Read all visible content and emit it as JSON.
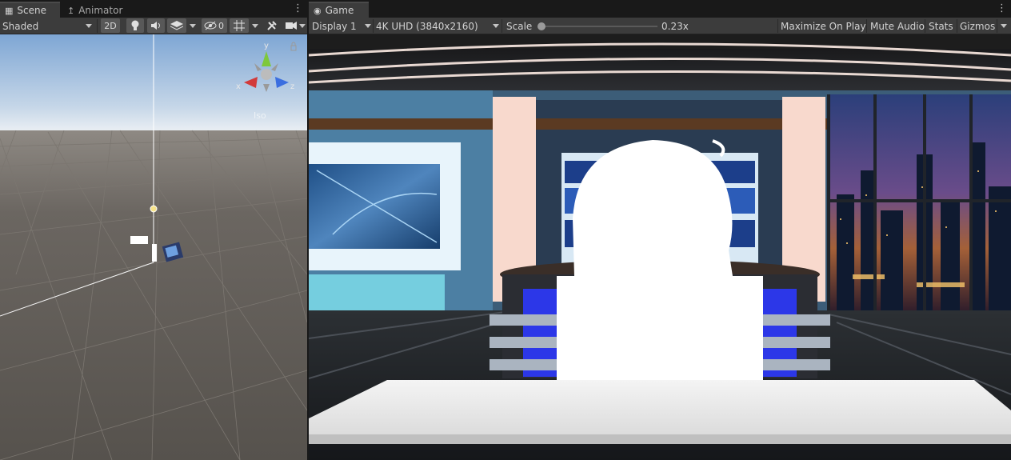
{
  "scene_panel": {
    "tabs": [
      {
        "label": "Scene",
        "icon": "grid-icon",
        "active": true
      },
      {
        "label": "Animator",
        "icon": "animator-icon",
        "active": false
      }
    ],
    "toolbar": {
      "draw_mode": "Shaded",
      "mode_2d": "2D",
      "hidden_count": "0"
    },
    "gizmo": {
      "y_label": "y",
      "x_label": "x",
      "z_label": "z",
      "projection_label": "Iso"
    }
  },
  "game_panel": {
    "tabs": [
      {
        "label": "Game",
        "icon": "gamepad-icon",
        "active": true
      }
    ],
    "toolbar": {
      "display": "Display 1",
      "resolution": "4K UHD (3840x2160)",
      "scale_label": "Scale",
      "scale_value": "0.23x",
      "scale_fraction": 0.0,
      "maximize": "Maximize On Play",
      "mute": "Mute Audio",
      "stats": "Stats",
      "gizmos": "Gizmos"
    }
  },
  "colors": {
    "editor_bg": "#191919",
    "toolbar_bg": "#3c3c3c",
    "tab_active": "#3c3c3c",
    "button_bg": "#585858",
    "sky_top": "#7ea6d4",
    "ground": "#5d5954",
    "axis_y": "#7ec83c",
    "axis_x": "#d23a3a",
    "axis_z": "#3a6ee0"
  }
}
